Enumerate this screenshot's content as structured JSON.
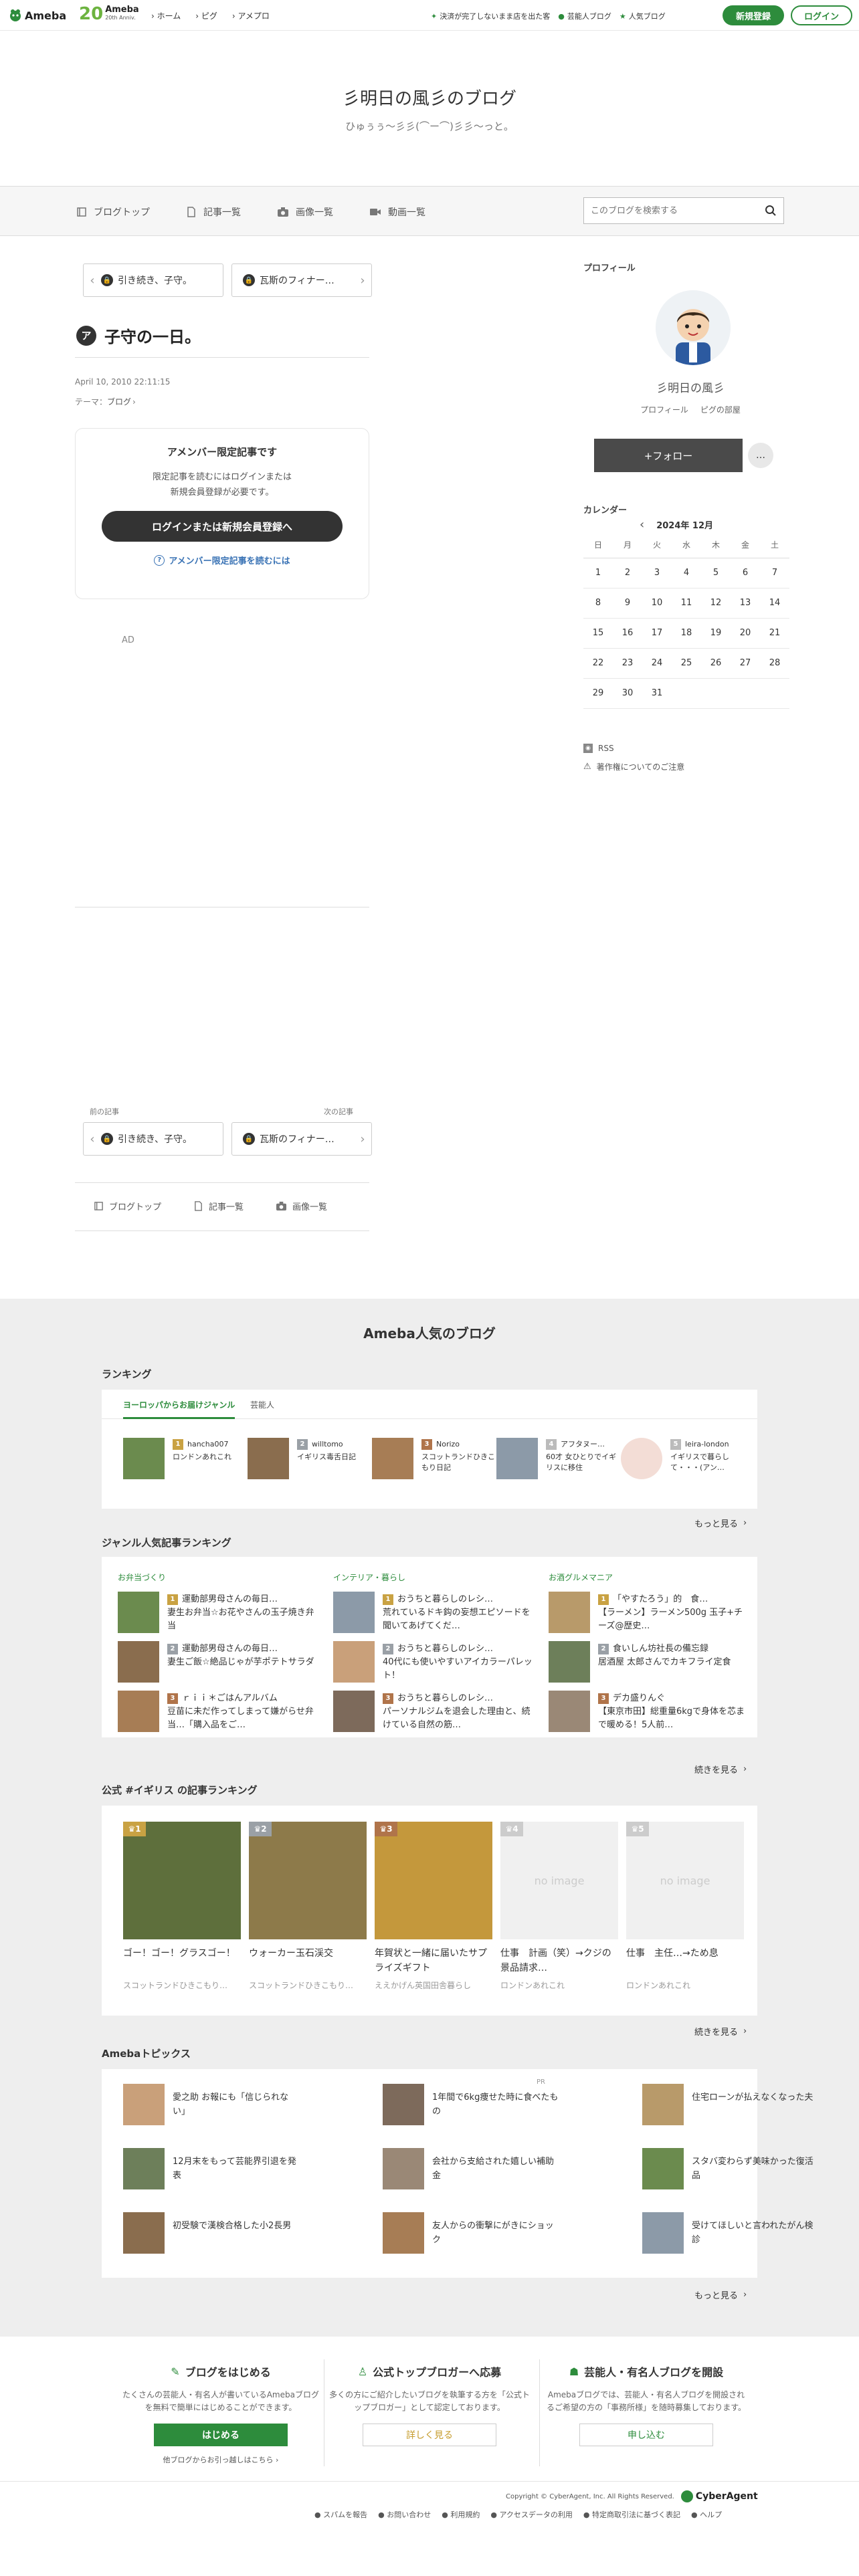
{
  "header": {
    "logo": "Ameba",
    "anniv": "Ameba",
    "anniv_sub": "20th Anniv.",
    "breadcrumb": [
      "ホーム",
      "ピグ",
      "アメプロ"
    ],
    "campaign": "決済が完了しないまま店を出た客",
    "celeb": "芸能人ブログ",
    "popular": "人気ブログ",
    "signup": "新規登録",
    "login": "ログイン"
  },
  "blog": {
    "title": "彡明日の風彡のブログ",
    "subtitle": "ひゅぅぅ～彡彡(⌒ー⌒)彡彡～っと。"
  },
  "nav": {
    "items": [
      "ブログトップ",
      "記事一覧",
      "画像一覧",
      "動画一覧"
    ],
    "search_placeholder": "このブログを検索する"
  },
  "pager_top": {
    "prev": "引き続き、子守。",
    "next": "瓦斯のフィナー…"
  },
  "article": {
    "title": "子守の一日。",
    "date": "April 10, 2010 22:11:15",
    "theme_label": "テーマ：",
    "theme": "ブログ",
    "lock_title": "アメンバー限定記事です",
    "lock_text1": "限定記事を読むにはログインまたは",
    "lock_text2": "新規会員登録が必要です。",
    "lock_button": "ログインまたは新規会員登録へ",
    "lock_link": "アメンバー限定記事を読むには",
    "ad": "AD"
  },
  "pager_bottom": {
    "prev_label": "前の記事",
    "next_label": "次の記事",
    "prev": "引き続き、子守。",
    "next": "瓦斯のフィナー…"
  },
  "bottom_nav": [
    "ブログトップ",
    "記事一覧",
    "画像一覧"
  ],
  "profile": {
    "heading": "プロフィール",
    "name": "彡明日の風彡",
    "link1": "プロフィール",
    "link2": "ピグの部屋",
    "follow": "+フォロー",
    "more": "…"
  },
  "calendar": {
    "heading": "カレンダー",
    "month": "2024年 12月",
    "days": [
      "日",
      "月",
      "火",
      "水",
      "木",
      "金",
      "土"
    ],
    "weeks": [
      [
        "1",
        "2",
        "3",
        "4",
        "5",
        "6",
        "7"
      ],
      [
        "8",
        "9",
        "10",
        "11",
        "12",
        "13",
        "14"
      ],
      [
        "15",
        "16",
        "17",
        "18",
        "19",
        "20",
        "21"
      ],
      [
        "22",
        "23",
        "24",
        "25",
        "26",
        "27",
        "28"
      ],
      [
        "29",
        "30",
        "31",
        "",
        "",
        "",
        ""
      ]
    ]
  },
  "links": {
    "rss": "RSS",
    "copyright": "著作権についてのご注意"
  },
  "popular": {
    "heading": "Ameba人気のブログ",
    "ranking_h": "ランキング",
    "tabs": [
      "ヨーロッパからお届けジャンル",
      "芸能人"
    ],
    "rank": [
      {
        "n": "1",
        "name": "hancha007",
        "desc": "ロンドンあれこれ"
      },
      {
        "n": "2",
        "name": "willtomo",
        "desc": "イギリス毒舌日記"
      },
      {
        "n": "3",
        "name": "Norizo",
        "desc": "スコットランドひきこもり日記"
      },
      {
        "n": "4",
        "name": "アフタヌー…",
        "desc": "60才 女ひとりでイギリスに移住"
      },
      {
        "n": "5",
        "name": "leira-london",
        "desc": "イギリスで暮らして・・・(アン…"
      }
    ],
    "more": "もっと見る",
    "genre_h": "ジャンル人気記事ランキング",
    "genres": [
      {
        "name": "お弁当づくり",
        "items": [
          {
            "n": "1",
            "t": "運動部男母さんの毎日…",
            "t2": "妻生お弁当☆お花やさんの玉子焼き弁当"
          },
          {
            "n": "2",
            "t": "運動部男母さんの毎日…",
            "t2": "妻生ご飯☆絶品じゃが芋ポテトサラダ"
          },
          {
            "n": "3",
            "t": "ｒｉｉ＊ごはんアルバム",
            "t2": "豆苗に未だ作ってしまって嫌がらせ弁当…「購入品をご…"
          }
        ]
      },
      {
        "name": "インテリア・暮らし",
        "items": [
          {
            "n": "1",
            "t": "おうちと暮らしのレシ…",
            "t2": "荒れているドキ鈎の妄想エピソードを聞いてあげてくだ…"
          },
          {
            "n": "2",
            "t": "おうちと暮らしのレシ…",
            "t2": "40代にも使いやすいアイカラーパレット！"
          },
          {
            "n": "3",
            "t": "おうちと暮らしのレシ…",
            "t2": "パーソナルジムを退会した理由と、続けている自然の筋…"
          }
        ]
      },
      {
        "name": "お酒グルメマニア",
        "items": [
          {
            "n": "1",
            "t": "「やすたろう」的　食…",
            "t2": "【ラーメン】ラーメン500g 玉子+チーズ@歴史…"
          },
          {
            "n": "2",
            "t": "食いしん坊社長の備忘録",
            "t2": "居酒屋 太郎さんでカキフライ定食"
          },
          {
            "n": "3",
            "t": "デカ盛りんぐ",
            "t2": "【東京市田】総重量6kgで身体を芯まで暖める！5人前…"
          }
        ]
      }
    ],
    "more2": "続きを見る",
    "hashtag_h": "公式 #イギリス の記事ランキング",
    "hashtag": [
      {
        "n": "1",
        "t": "ゴー！ゴー！グラスゴー！",
        "a": "スコットランドひきこもり…"
      },
      {
        "n": "2",
        "t": "ウォーカー玉石渓交",
        "a": "スコットランドひきこもり…"
      },
      {
        "n": "3",
        "t": "年賀状と一緒に届いたサプライズギフト",
        "a": "ええかげん英国田舎暮らし"
      },
      {
        "n": "4",
        "t": "仕事　計画（笑）→クジの景品請求…",
        "a": "ロンドンあれこれ"
      },
      {
        "n": "5",
        "t": "仕事　主任…→ため息",
        "a": "ロンドンあれこれ"
      }
    ],
    "noimage": "no image",
    "more3": "続きを見る",
    "topics_h": "Amebaトピックス",
    "topics": [
      [
        "愛之助 お報にも「信じられない」",
        "1年間で6kg痩せた時に食べたもの",
        "住宅ローンが払えなくなった夫"
      ],
      [
        "12月末をもって芸能界引退を発表",
        "会社から支給された嬉しい補助金",
        "スタバ変わらず美味かった復活品"
      ],
      [
        "初受験で漢検合格した小2長男",
        "友人からの衝撃にがきにショック",
        "受けてほしいと言われたがん検診"
      ]
    ],
    "topics_pr": "PR",
    "more4": "もっと見る"
  },
  "footer": {
    "col1_h": "ブログをはじめる",
    "col1_p": "たくさんの芸能人・有名人が書いているAmebaブログを無料で簡単にはじめることができます。",
    "col1_btn": "はじめる",
    "col1_sub": "他ブログからお引っ越しはこちら",
    "col2_h": "公式トップブロガーへ応募",
    "col2_p": "多くの方にご紹介したいブログを執筆する方を「公式トップブロガー」として認定しております。",
    "col2_btn": "詳しく見る",
    "col3_h": "芸能人・有名人ブログを開設",
    "col3_p": "Amebaブログでは、芸能人・有名人ブログを開設されるご希望の方の「事務所様」を随時募集しております。",
    "col3_btn": "申し込む",
    "copyright": "Copyright © CyberAgent, Inc. All Rights Reserved.",
    "ca": "CyberAgent",
    "links": [
      "スパムを報告",
      "お問い合わせ",
      "利用規約",
      "アクセスデータの利用",
      "特定商取引法に基づく表記",
      "ヘルプ"
    ]
  }
}
